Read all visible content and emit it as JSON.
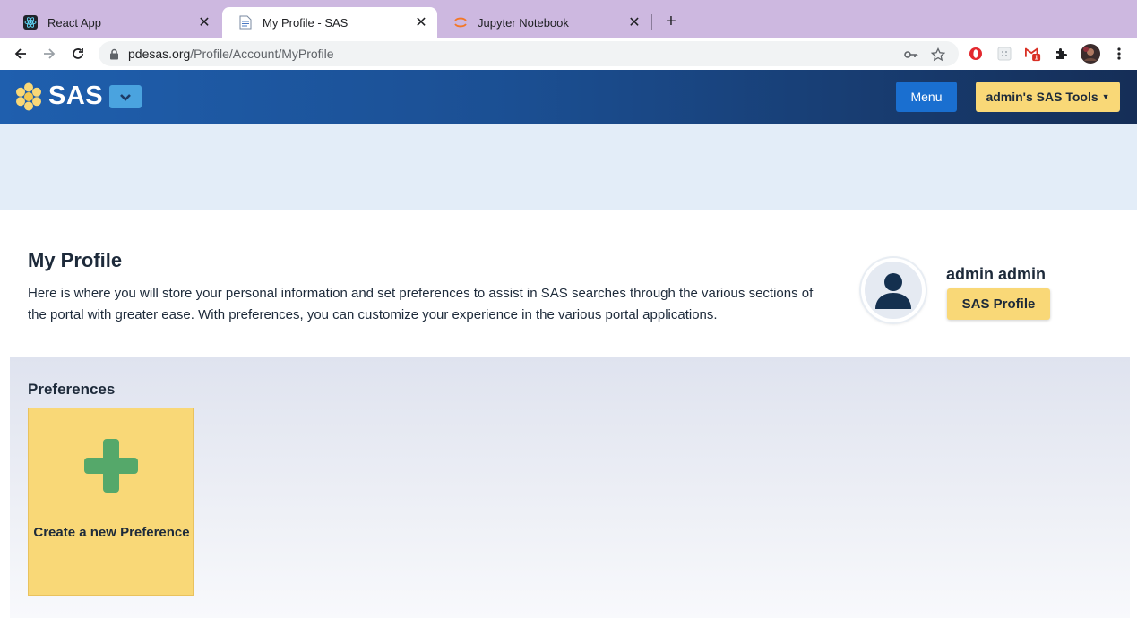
{
  "browser": {
    "tabs": [
      {
        "title": "React App",
        "favicon": "react-icon"
      },
      {
        "title": "My Profile - SAS",
        "favicon": "document-icon"
      },
      {
        "title": "Jupyter Notebook",
        "favicon": "jupyter-icon"
      }
    ],
    "active_tab": 1,
    "url_host": "pdesas.org",
    "url_path": "/Profile/Account/MyProfile",
    "extensions": [
      "opera-icon",
      "grid-icon",
      "gmail-icon",
      "puzzle-icon",
      "profile-avatar",
      "more-icon"
    ],
    "gmail_badge": "1"
  },
  "header": {
    "logo_text": "SAS",
    "menu_label": "Menu",
    "tools_label": "admin's SAS Tools",
    "colors": {
      "primary": "#1f5fae",
      "accent": "#f9d877",
      "menu_button": "#1a6fd0"
    }
  },
  "profile": {
    "title": "My Profile",
    "description": "Here is where you will store your personal information and set preferences to assist in SAS searches through the various sections of the portal with greater ease. With preferences, you can customize your experience in the various portal applications.",
    "user_name": "admin admin",
    "profile_button": "SAS Profile"
  },
  "preferences": {
    "title": "Preferences",
    "create_label": "Create a new Preference",
    "plus_color": "#55a86a"
  }
}
